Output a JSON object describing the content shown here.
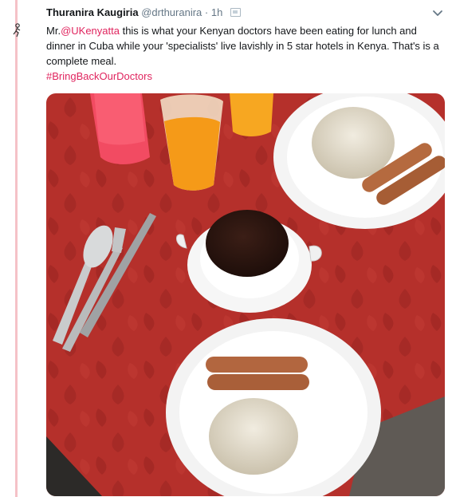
{
  "tweet": {
    "author_name": "Thuranira Kaugiria",
    "handle": "@drthuranira",
    "separator": "·",
    "time": "1h",
    "text_prefix": "Mr.",
    "mention": "@UKenyatta",
    "text_body": " this is what your Kenyan doctors have been eating for lunch and dinner in Cuba while your 'specialists' live lavishly in 5 star hotels in Kenya. That's is a complete meal.",
    "hashtag": "#BringBackOurDoctors"
  },
  "icons": {
    "verified": "verified-badge-icon",
    "dropdown": "chevron-down-icon",
    "thread": "person-figure-icon"
  },
  "colors": {
    "link": "#e0245e",
    "text": "#14171a",
    "muted": "#657786",
    "thread_line": "#f5c2c7",
    "tablecloth": "#b5302b"
  }
}
